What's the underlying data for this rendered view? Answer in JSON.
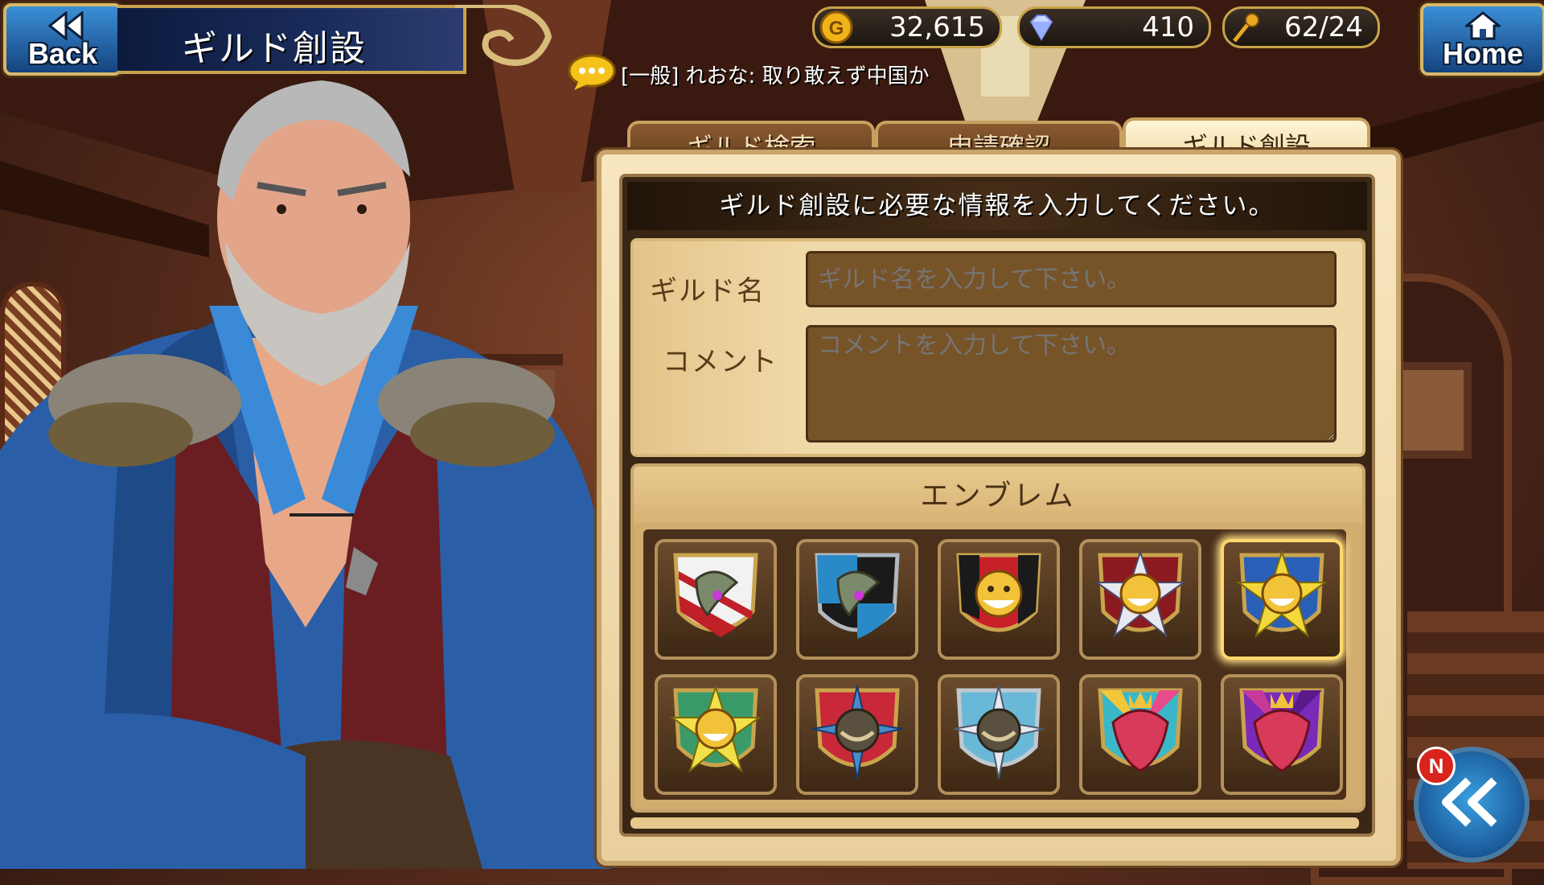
{
  "header": {
    "back_label": "Back",
    "title": "ギルド創設",
    "home_label": "Home"
  },
  "resources": {
    "gold": "32,615",
    "gems": "410",
    "stamina": "62/24"
  },
  "chat": {
    "message": "[一般] れおな: 取り敢えず中国か"
  },
  "tabs": [
    {
      "label": "ギルド検索",
      "active": false
    },
    {
      "label": "申請確認",
      "active": false
    },
    {
      "label": "ギルド創設",
      "active": true
    }
  ],
  "form": {
    "instruction": "ギルド創設に必要な情報を入力してください。",
    "guild_name_label": "ギルド名",
    "guild_name_placeholder": "ギルド名を入力して下さい。",
    "comment_label": "コメント",
    "comment_placeholder": "コメントを入力して下さい。"
  },
  "emblems": {
    "title": "エンブレム",
    "selected_index": 4,
    "items": [
      {
        "icon": "dragon-shield-red-white-icon"
      },
      {
        "icon": "dragon-shield-blue-black-icon"
      },
      {
        "icon": "sun-beast-red-black-icon"
      },
      {
        "icon": "sun-beast-star-red-icon"
      },
      {
        "icon": "sun-beast-star-yellow-icon"
      },
      {
        "icon": "sun-beast-star-green-yellow-icon"
      },
      {
        "icon": "orb-star-red-icon"
      },
      {
        "icon": "orb-star-blue-icon"
      },
      {
        "icon": "crowned-bird-blue-icon"
      },
      {
        "icon": "crowned-bird-purple-icon"
      }
    ]
  },
  "badges": {
    "new_badge": "N"
  },
  "colors": {
    "accent_gold": "#c8a24c",
    "button_blue": "#1a5a9a",
    "panel_cream": "#f0d9a8",
    "input_brown": "#775328"
  }
}
